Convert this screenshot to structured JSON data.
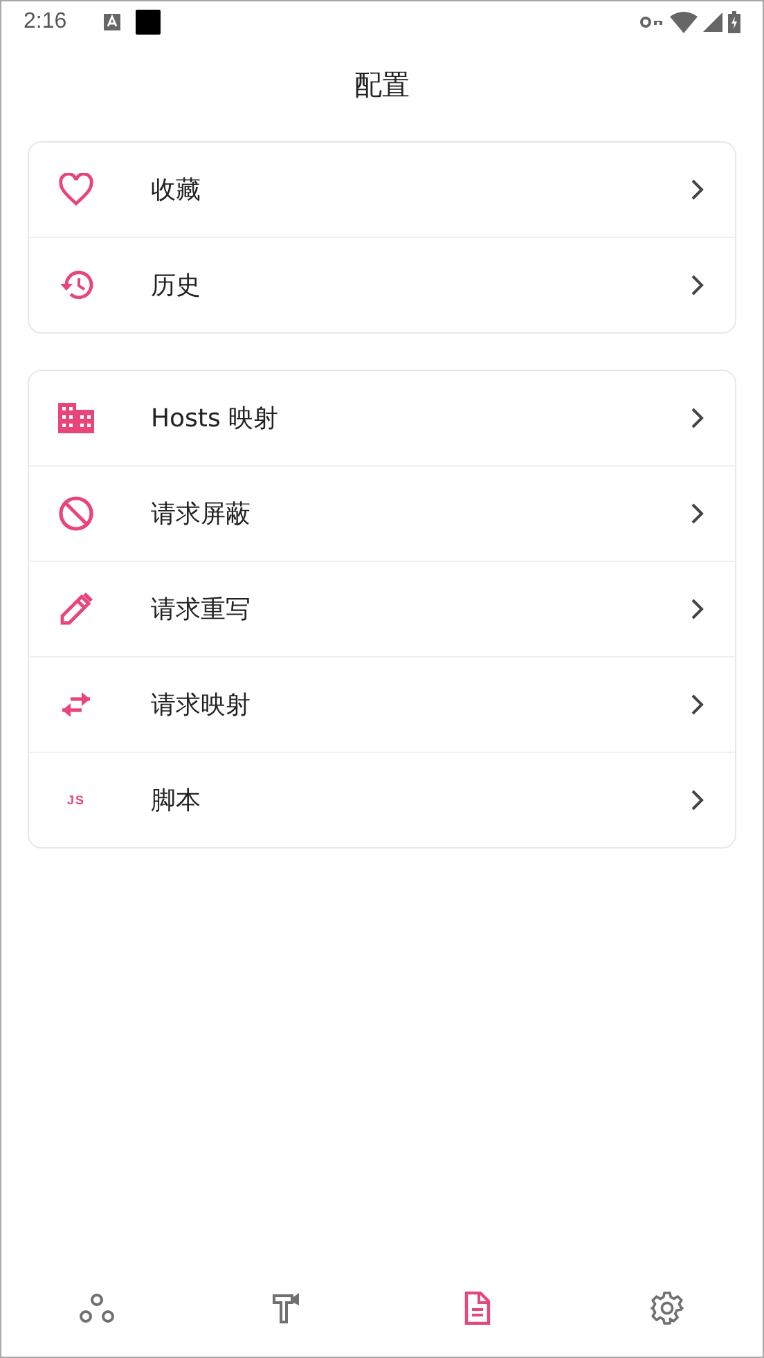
{
  "status_bar": {
    "time": "2:16"
  },
  "title": "配置",
  "groups": [
    {
      "items": [
        {
          "label": "收藏"
        },
        {
          "label": "历史"
        }
      ]
    },
    {
      "items": [
        {
          "label": "Hosts 映射"
        },
        {
          "label": "请求屏蔽"
        },
        {
          "label": "请求重写"
        },
        {
          "label": "请求映射"
        },
        {
          "icon_text": "JS",
          "label": "脚本"
        }
      ]
    }
  ],
  "nav": [
    {
      "selected": false
    },
    {
      "selected": false
    },
    {
      "selected": true
    },
    {
      "selected": false
    }
  ]
}
